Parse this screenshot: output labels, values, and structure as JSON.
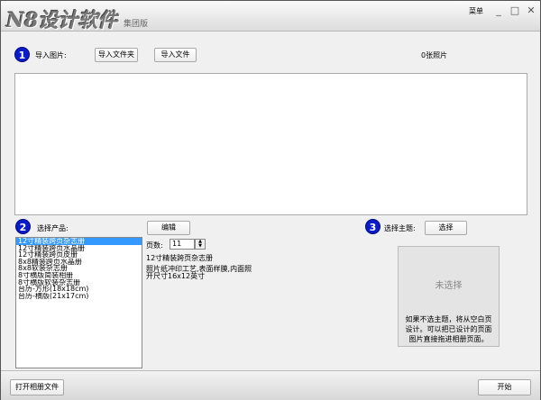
{
  "titlebar": {
    "logo": "N8设计软件",
    "edition": "集团版",
    "menu": "菜单",
    "minimize": "_",
    "maximize": "□",
    "close": "✕"
  },
  "step1": {
    "num": "1",
    "label": "导入图片:",
    "import_folder": "导入文件夹",
    "import_file": "导入文件",
    "count": "0张照片"
  },
  "step2": {
    "num": "2",
    "label": "选择产品:",
    "edit": "编辑",
    "products": [
      "12寸精装跨页杂志册",
      "12寸精装跨页水晶册",
      "12寸精装跨页皮册",
      "8x8精装跨页水晶册",
      "8x8软装杂志册",
      "8寸横版简装相册",
      "8寸横版软装杂志册",
      "台历-方形(18x18cm)",
      "台历-横版(21x17cm)"
    ],
    "selected_index": 0,
    "pages_label": "页数:",
    "pages_value": "11",
    "detail_title": "12寸精装跨页杂志册",
    "detail_desc1": "照片纸冲印工艺,表面样膜,内面照",
    "detail_desc2": "开尺寸16x12英寸"
  },
  "step3": {
    "num": "3",
    "label": "选择主题:",
    "choose": "选择",
    "none": "未选择",
    "hint": "如果不选主题，将从空白页设计。可以把已设计的页面图片直接拖进相册页面。"
  },
  "footer": {
    "open": "打开相册文件",
    "start": "开始"
  }
}
